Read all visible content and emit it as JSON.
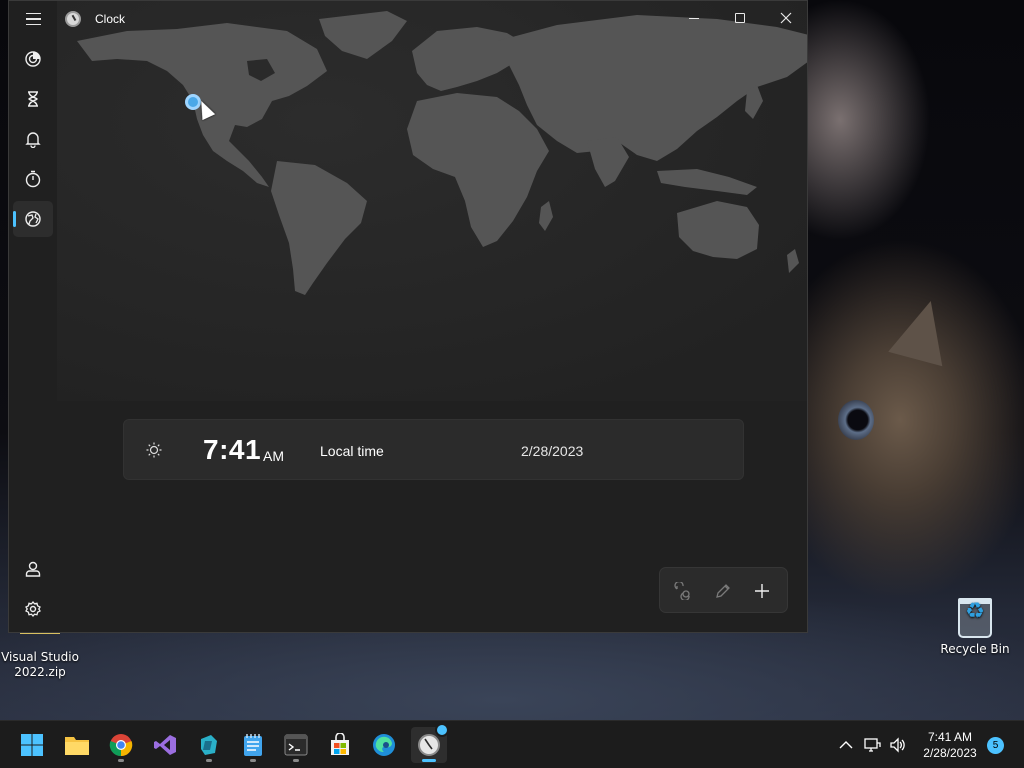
{
  "app": {
    "title": "Clock"
  },
  "nav": {
    "items": [
      {
        "name": "focus-sessions",
        "icon": "focus-icon"
      },
      {
        "name": "timer",
        "icon": "hourglass-icon"
      },
      {
        "name": "alarm",
        "icon": "bell-icon"
      },
      {
        "name": "stopwatch",
        "icon": "stopwatch-icon"
      },
      {
        "name": "world-clock",
        "icon": "globe-icon",
        "active": true
      }
    ],
    "bottom": [
      {
        "name": "account",
        "icon": "person-icon"
      },
      {
        "name": "settings",
        "icon": "gear-icon"
      }
    ]
  },
  "world_clock": {
    "time": "7:41",
    "ampm": "AM",
    "label": "Local time",
    "date": "2/28/2023"
  },
  "commands": {
    "compare": "compare-icon",
    "edit": "pencil-icon",
    "add": "+"
  },
  "desktop": {
    "icons": [
      {
        "label": "Visual Studio 2022.zip"
      },
      {
        "label": "Recycle Bin"
      }
    ]
  },
  "taskbar": {
    "apps": [
      "start",
      "file-explorer",
      "chrome",
      "visual-studio",
      "azure-data-studio",
      "notepad",
      "terminal",
      "microsoft-store",
      "edge",
      "clock"
    ],
    "clock_time": "7:41 AM",
    "clock_date": "2/28/2023",
    "notification_count": "5"
  },
  "colors": {
    "accent": "#4cc2ff",
    "window_bg": "#202020",
    "card_bg": "#2b2b2b",
    "land": "#555555"
  }
}
